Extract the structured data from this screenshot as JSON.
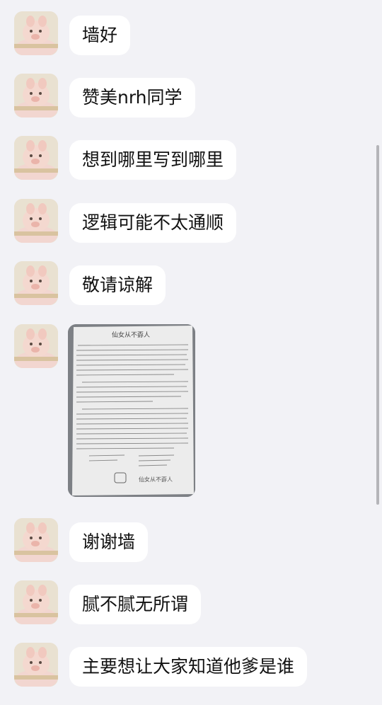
{
  "messages": [
    {
      "type": "text",
      "text": "墙好"
    },
    {
      "type": "text",
      "text": "赞美nrh同学"
    },
    {
      "type": "text",
      "text": "想到哪里写到哪里"
    },
    {
      "type": "text",
      "text": "逻辑可能不太通顺"
    },
    {
      "type": "text",
      "text": "敬请谅解"
    },
    {
      "type": "image",
      "title_text": "仙女从不孬人",
      "signature_text": "仙女从不孬人",
      "icon": "handwritten-letter-photo"
    },
    {
      "type": "text",
      "text": "谢谢墙"
    },
    {
      "type": "text",
      "text": "腻不腻无所谓"
    },
    {
      "type": "text",
      "text": "主要想让大家知道他爹是谁"
    }
  ],
  "sender": {
    "avatar_icon": "cartoon-pig-avatar-icon"
  },
  "colors": {
    "background": "#f2f2f6",
    "bubble": "#ffffff",
    "text": "#111111"
  }
}
